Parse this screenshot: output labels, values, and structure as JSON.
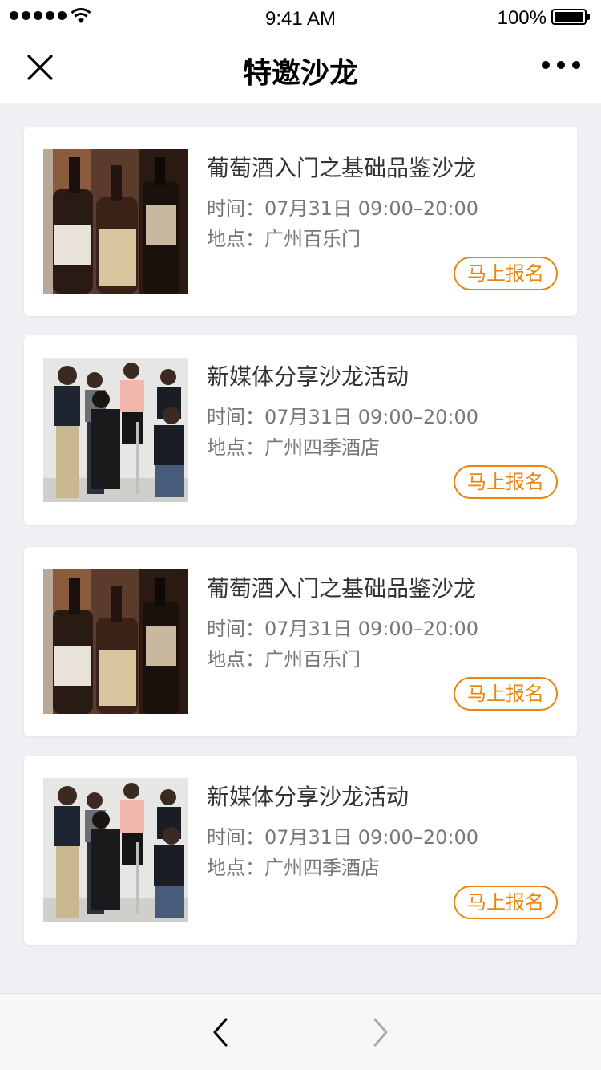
{
  "status_bar": {
    "time": "9:41 AM",
    "battery": "100%",
    "signal_icon": "signal-dots",
    "wifi_icon": "wifi-icon",
    "battery_icon": "battery-icon"
  },
  "nav": {
    "title": "特邀沙龙",
    "close_icon": "close-icon",
    "more_icon": "more-icon"
  },
  "events": [
    {
      "title": "葡萄酒入门之基础品鉴沙龙",
      "time": "时间：07月31日 09:00–20:00",
      "place": "地点：广州百乐门",
      "button": "马上报名",
      "image": "wine-bottles"
    },
    {
      "title": "新媒体分享沙龙活动",
      "time": "时间：07月31日 09:00–20:00",
      "place": "地点：广州四季酒店",
      "button": "马上报名",
      "image": "group-photo"
    },
    {
      "title": "葡萄酒入门之基础品鉴沙龙",
      "time": "时间：07月31日 09:00–20:00",
      "place": "地点：广州百乐门",
      "button": "马上报名",
      "image": "wine-bottles"
    },
    {
      "title": "新媒体分享沙龙活动",
      "time": "时间：07月31日 09:00–20:00",
      "place": "地点：广州四季酒店",
      "button": "马上报名",
      "image": "group-photo"
    }
  ],
  "bottom_bar": {
    "back_icon": "chevron-left-icon",
    "forward_icon": "chevron-right-icon"
  },
  "colors": {
    "accent": "#e8850e",
    "background": "#efeff4"
  }
}
